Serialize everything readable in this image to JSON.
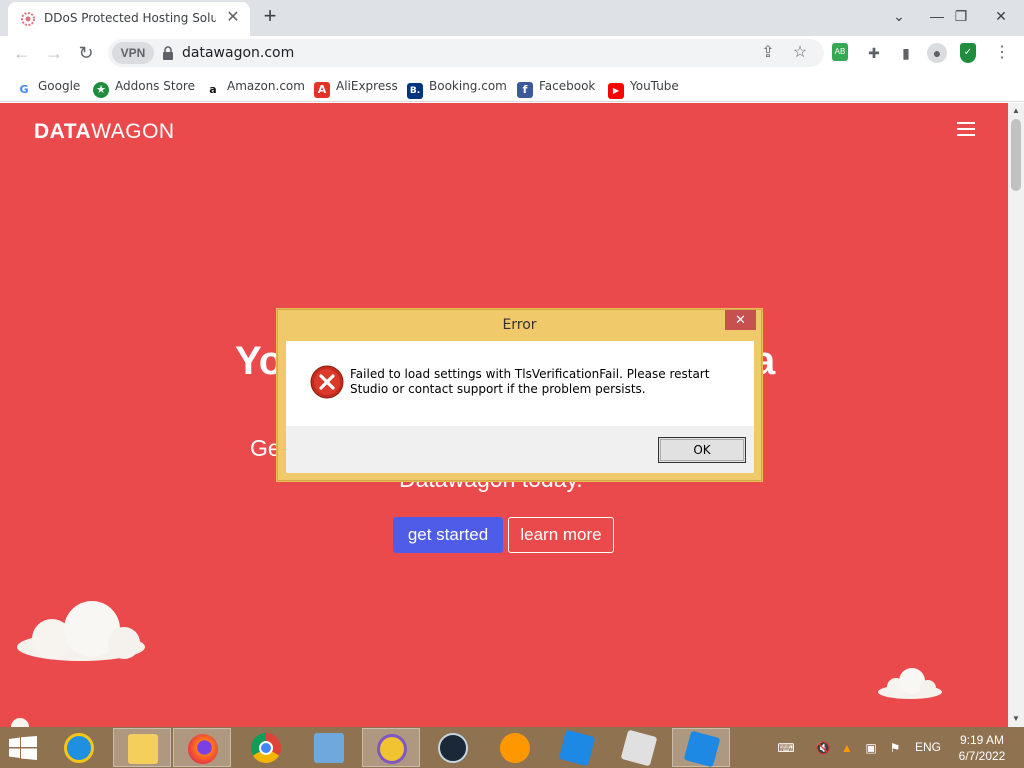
{
  "browser": {
    "tab": {
      "title": "DDoS Protected Hosting Solutio",
      "close": "✕"
    },
    "new_tab": "+",
    "window_controls": {
      "minimize": "—",
      "restore": "❐",
      "close": "✕"
    },
    "nav": {
      "back": "←",
      "forward": "→",
      "reload": "↻"
    },
    "vpn_label": "VPN",
    "url": "datawagon.com",
    "bookmarks": [
      {
        "label": "Google",
        "icon": "google-icon"
      },
      {
        "label": "Addons Store",
        "icon": "addons-store-icon"
      },
      {
        "label": "Amazon.com",
        "icon": "amazon-icon"
      },
      {
        "label": "AliExpress",
        "icon": "aliexpress-icon"
      },
      {
        "label": "Booking.com",
        "icon": "booking-icon"
      },
      {
        "label": "Facebook",
        "icon": "facebook-icon"
      },
      {
        "label": "YouTube",
        "icon": "youtube-icon"
      }
    ],
    "bookmark_glyphs": {
      "google": "G",
      "addons": "★",
      "amazon": "a",
      "aliexpress": "A",
      "booking": "B.",
      "facebook": "f",
      "youtube": "▶"
    }
  },
  "page": {
    "logo_bold": "DATA",
    "logo_light": "WAGON",
    "hero_fragments": {
      "left": "Yo",
      "right": "a",
      "sub_left": "Ge",
      "sub_bottom": "Datawagon today."
    },
    "get_started": "get started",
    "learn_more": "learn more",
    "background_color": "#eb4a4c"
  },
  "dialog": {
    "title": "Error",
    "close": "✕",
    "message": "Failed to load settings with TlsVerificationFail. Please restart Studio or contact support if the problem persists.",
    "ok": "OK"
  },
  "taskbar": {
    "apps": [
      {
        "name": "internet-explorer"
      },
      {
        "name": "file-explorer"
      },
      {
        "name": "firefox"
      },
      {
        "name": "chrome"
      },
      {
        "name": "control-panel"
      },
      {
        "name": "keepass"
      },
      {
        "name": "steam"
      },
      {
        "name": "sublime-text"
      },
      {
        "name": "roblox-studio"
      },
      {
        "name": "roblox-player"
      },
      {
        "name": "roblox-studio-active"
      }
    ],
    "language": "ENG",
    "time": "9:19 AM",
    "date": "6/7/2022"
  }
}
